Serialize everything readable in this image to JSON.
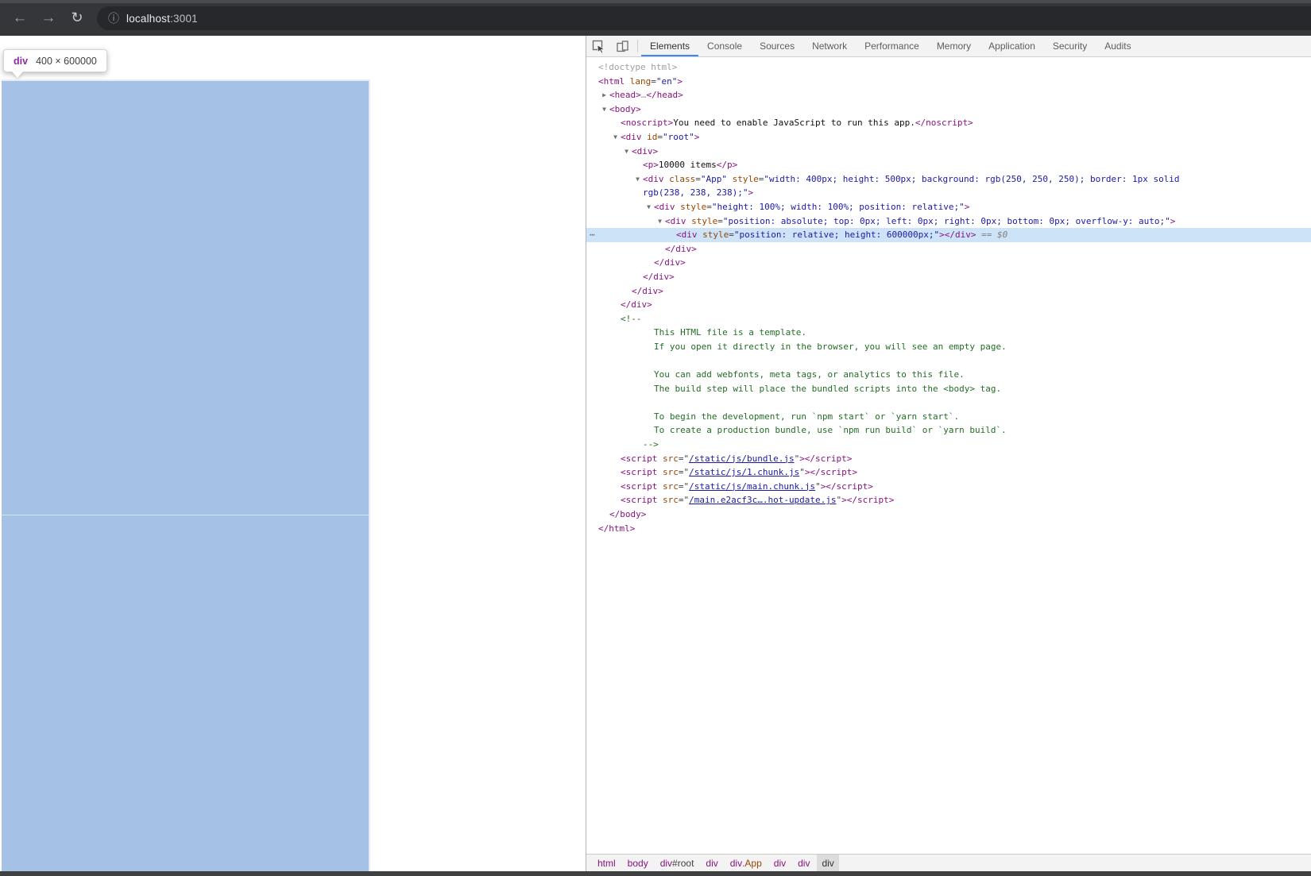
{
  "browser": {
    "back_icon": "←",
    "forward_icon": "→",
    "refresh_icon": "↻",
    "info_icon": "ⓘ",
    "url_host": "localhost",
    "url_port": ":3001"
  },
  "page": {
    "tooltip": {
      "tag": "div",
      "size": "400 × 600000"
    },
    "highlight_color": "#a5c2e6"
  },
  "devtools": {
    "tabs": [
      {
        "label": "Elements",
        "active": true
      },
      {
        "label": "Console"
      },
      {
        "label": "Sources"
      },
      {
        "label": "Network"
      },
      {
        "label": "Performance"
      },
      {
        "label": "Memory"
      },
      {
        "label": "Application"
      },
      {
        "label": "Security"
      },
      {
        "label": "Audits"
      }
    ],
    "tree": [
      {
        "i": 15,
        "s": [
          [
            "g",
            "<!doctype html>"
          ]
        ]
      },
      {
        "i": 15,
        "s": [
          [
            "t",
            "<html"
          ],
          [
            "a",
            " lang"
          ],
          [
            "p",
            "="
          ],
          [
            "v",
            "\"en\""
          ],
          [
            "t",
            ">"
          ]
        ]
      },
      {
        "i": 29,
        "a": "r",
        "s": [
          [
            "t",
            "<head>"
          ],
          [
            "g",
            "…"
          ],
          [
            "t",
            "</head>"
          ]
        ]
      },
      {
        "i": 29,
        "a": "d",
        "s": [
          [
            "t",
            "<body>"
          ]
        ]
      },
      {
        "i": 43,
        "s": [
          [
            "t",
            "<noscript>"
          ],
          [
            "x",
            "You need to enable JavaScript to run this app."
          ],
          [
            "t",
            "</noscript>"
          ]
        ]
      },
      {
        "i": 43,
        "a": "d",
        "s": [
          [
            "t",
            "<div"
          ],
          [
            "a",
            " id"
          ],
          [
            "p",
            "="
          ],
          [
            "v",
            "\"root\""
          ],
          [
            "t",
            ">"
          ]
        ]
      },
      {
        "i": 57,
        "a": "d",
        "s": [
          [
            "t",
            "<div>"
          ]
        ]
      },
      {
        "i": 71,
        "s": [
          [
            "t",
            "<p>"
          ],
          [
            "x",
            "10000 items"
          ],
          [
            "t",
            "</p>"
          ]
        ]
      },
      {
        "i": 71,
        "a": "d",
        "s": [
          [
            "t",
            "<div"
          ],
          [
            "a",
            " class"
          ],
          [
            "p",
            "="
          ],
          [
            "v",
            "\"App\""
          ],
          [
            "a",
            " style"
          ],
          [
            "p",
            "="
          ],
          [
            "v",
            "\"width: 400px; height: 500px; background: rgb(250, 250, 250); border: 1px solid"
          ]
        ]
      },
      {
        "i": 71,
        "s": [
          [
            "v",
            "rgb(238, 238, 238);\""
          ],
          [
            "t",
            ">"
          ]
        ]
      },
      {
        "i": 85,
        "a": "d",
        "s": [
          [
            "t",
            "<div"
          ],
          [
            "a",
            " style"
          ],
          [
            "p",
            "="
          ],
          [
            "v",
            "\"height: 100%; width: 100%; position: relative;\""
          ],
          [
            "t",
            ">"
          ]
        ]
      },
      {
        "i": 99,
        "a": "d",
        "s": [
          [
            "t",
            "<div"
          ],
          [
            "a",
            " style"
          ],
          [
            "p",
            "="
          ],
          [
            "v",
            "\"position: absolute; top: 0px; left: 0px; right: 0px; bottom: 0px; overflow-y: auto;\""
          ],
          [
            "t",
            ">"
          ]
        ]
      },
      {
        "i": 113,
        "sel": true,
        "dots": "⋯",
        "s": [
          [
            "t",
            "<div"
          ],
          [
            "a",
            " style"
          ],
          [
            "p",
            "="
          ],
          [
            "v",
            "\"position: relative; height: 600000px;\""
          ],
          [
            "t",
            "></div>"
          ],
          [
            "eq",
            " == "
          ],
          [
            "dz",
            "$0"
          ]
        ]
      },
      {
        "i": 99,
        "s": [
          [
            "t",
            "</div>"
          ]
        ]
      },
      {
        "i": 85,
        "s": [
          [
            "t",
            "</div>"
          ]
        ]
      },
      {
        "i": 71,
        "s": [
          [
            "t",
            "</div>"
          ]
        ]
      },
      {
        "i": 57,
        "s": [
          [
            "t",
            "</div>"
          ]
        ]
      },
      {
        "i": 43,
        "s": [
          [
            "t",
            "</div>"
          ]
        ]
      },
      {
        "i": 43,
        "s": [
          [
            "c",
            "<!--"
          ]
        ]
      },
      {
        "i": 85,
        "s": [
          [
            "c",
            "This HTML file is a template."
          ]
        ]
      },
      {
        "i": 85,
        "s": [
          [
            "c",
            "If you open it directly in the browser, you will see an empty page."
          ]
        ]
      },
      {
        "i": 85,
        "s": []
      },
      {
        "i": 85,
        "s": [
          [
            "c",
            "You can add webfonts, meta tags, or analytics to this file."
          ]
        ]
      },
      {
        "i": 85,
        "s": [
          [
            "c",
            "The build step will place the bundled scripts into the <body> tag."
          ]
        ]
      },
      {
        "i": 85,
        "s": []
      },
      {
        "i": 85,
        "s": [
          [
            "c",
            "To begin the development, run `npm start` or `yarn start`."
          ]
        ]
      },
      {
        "i": 85,
        "s": [
          [
            "c",
            "To create a production bundle, use `npm run build` or `yarn build`."
          ]
        ]
      },
      {
        "i": 71,
        "s": [
          [
            "c",
            "-->"
          ]
        ]
      },
      {
        "i": 43,
        "s": [
          [
            "t",
            "<script"
          ],
          [
            "a",
            " src"
          ],
          [
            "p",
            "=\""
          ],
          [
            "l",
            "/static/js/bundle.js"
          ],
          [
            "p",
            "\""
          ],
          [
            "t",
            "></script>"
          ]
        ]
      },
      {
        "i": 43,
        "s": [
          [
            "t",
            "<script"
          ],
          [
            "a",
            " src"
          ],
          [
            "p",
            "=\""
          ],
          [
            "l",
            "/static/js/1.chunk.js"
          ],
          [
            "p",
            "\""
          ],
          [
            "t",
            "></script>"
          ]
        ]
      },
      {
        "i": 43,
        "s": [
          [
            "t",
            "<script"
          ],
          [
            "a",
            " src"
          ],
          [
            "p",
            "=\""
          ],
          [
            "l",
            "/static/js/main.chunk.js"
          ],
          [
            "p",
            "\""
          ],
          [
            "t",
            "></script>"
          ]
        ]
      },
      {
        "i": 43,
        "s": [
          [
            "t",
            "<script"
          ],
          [
            "a",
            " src"
          ],
          [
            "p",
            "=\""
          ],
          [
            "l",
            "/main.e2acf3c….hot-update.js"
          ],
          [
            "p",
            "\""
          ],
          [
            "t",
            "></script>"
          ]
        ]
      },
      {
        "i": 29,
        "s": [
          [
            "t",
            "</body>"
          ]
        ]
      },
      {
        "i": 15,
        "s": [
          [
            "t",
            "</html>"
          ]
        ]
      }
    ],
    "breadcrumbs": [
      {
        "s": [
          [
            "t",
            "html"
          ]
        ]
      },
      {
        "s": [
          [
            "t",
            "body"
          ]
        ]
      },
      {
        "s": [
          [
            "t",
            "div"
          ],
          [
            "p",
            "#root"
          ]
        ]
      },
      {
        "s": [
          [
            "t",
            "div"
          ]
        ]
      },
      {
        "s": [
          [
            "t",
            "div"
          ],
          [
            "cl",
            ".App"
          ]
        ]
      },
      {
        "s": [
          [
            "t",
            "div"
          ]
        ]
      },
      {
        "s": [
          [
            "t",
            "div"
          ]
        ]
      },
      {
        "s": [
          [
            "pl",
            "div"
          ]
        ],
        "sel": true
      }
    ]
  },
  "colors": {
    "accent_blue": "#4285f4",
    "highlight_overlay": "#a5c2e6",
    "selected_row": "#cde3f8",
    "tag_purple": "#881280",
    "attr_orange": "#994500",
    "value_blue": "#1a1aa6",
    "comment_green": "#236e25",
    "chrome_dark": "#343639"
  }
}
